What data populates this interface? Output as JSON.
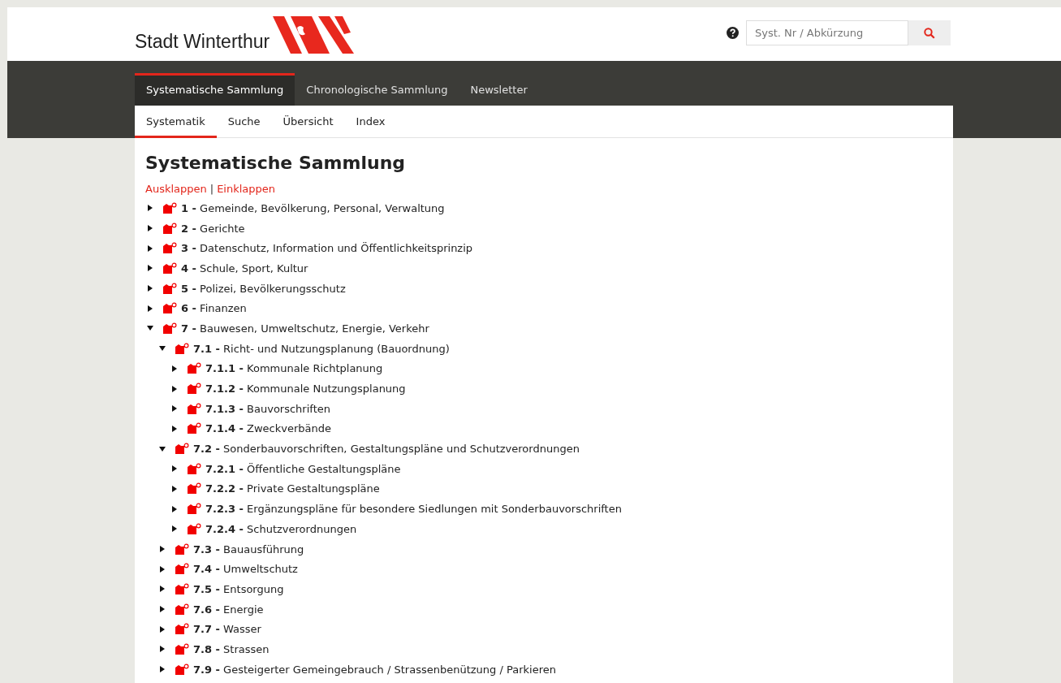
{
  "header": {
    "site_name": "Stadt Winterthur",
    "search": {
      "placeholder": "Syst. Nr / Abkürzung"
    }
  },
  "main_nav": [
    {
      "label": "Systematische Sammlung",
      "selected": true
    },
    {
      "label": "Chronologische Sammlung",
      "selected": false
    },
    {
      "label": "Newsletter",
      "selected": false
    }
  ],
  "sub_nav": [
    {
      "label": "Systematik",
      "selected": true
    },
    {
      "label": "Suche",
      "selected": false
    },
    {
      "label": "Übersicht",
      "selected": false
    },
    {
      "label": "Index",
      "selected": false
    }
  ],
  "page_title": "Systematische Sammlung",
  "tree_actions": [
    {
      "kind": "link",
      "label": "Ausklappen"
    },
    {
      "kind": "separator",
      "label": "|"
    },
    {
      "kind": "link",
      "label": "Einklappen"
    }
  ],
  "tree": [
    {
      "number": "1 -",
      "title": "Gemeinde, Bevölkerung, Personal, Verwaltung",
      "expanded": false
    },
    {
      "number": "2 -",
      "title": "Gerichte",
      "expanded": false
    },
    {
      "number": "3 -",
      "title": "Datenschutz, Information und Öffentlichkeitsprinzip",
      "expanded": false
    },
    {
      "number": "4 -",
      "title": "Schule, Sport, Kultur",
      "expanded": false
    },
    {
      "number": "5 -",
      "title": "Polizei, Bevölkerungsschutz",
      "expanded": false
    },
    {
      "number": "6 -",
      "title": "Finanzen",
      "expanded": false
    },
    {
      "number": "7 -",
      "title": "Bauwesen, Umweltschutz, Energie, Verkehr",
      "expanded": true,
      "children": [
        {
          "number": "7.1 -",
          "title": "Richt- und Nutzungsplanung (Bauordnung)",
          "expanded": true,
          "children": [
            {
              "number": "7.1.1 -",
              "title": "Kommunale Richtplanung",
              "expanded": false
            },
            {
              "number": "7.1.2 -",
              "title": "Kommunale Nutzungsplanung",
              "expanded": false
            },
            {
              "number": "7.1.3 -",
              "title": "Bauvorschriften",
              "expanded": false
            },
            {
              "number": "7.1.4 -",
              "title": "Zweckverbände",
              "expanded": false
            }
          ]
        },
        {
          "number": "7.2 -",
          "title": "Sonderbauvorschriften, Gestaltungspläne und Schutzverordnungen",
          "expanded": true,
          "children": [
            {
              "number": "7.2.1 -",
              "title": "Öffentliche Gestaltungspläne",
              "expanded": false
            },
            {
              "number": "7.2.2 -",
              "title": "Private Gestaltungspläne",
              "expanded": false
            },
            {
              "number": "7.2.3 -",
              "title": "Ergänzungspläne für besondere Siedlungen mit Sonderbauvorschriften",
              "expanded": false
            },
            {
              "number": "7.2.4 -",
              "title": "Schutzverordnungen",
              "expanded": false
            }
          ]
        },
        {
          "number": "7.3 -",
          "title": "Bauausführung",
          "expanded": false
        },
        {
          "number": "7.4 -",
          "title": "Umweltschutz",
          "expanded": false
        },
        {
          "number": "7.5 -",
          "title": "Entsorgung",
          "expanded": false
        },
        {
          "number": "7.6 -",
          "title": "Energie",
          "expanded": false
        },
        {
          "number": "7.7 -",
          "title": "Wasser",
          "expanded": false
        },
        {
          "number": "7.8 -",
          "title": "Strassen",
          "expanded": false
        },
        {
          "number": "7.9 -",
          "title": "Gesteigerter Gemeingebrauch / Strassenbenützung / Parkieren",
          "expanded": false
        }
      ]
    }
  ]
}
